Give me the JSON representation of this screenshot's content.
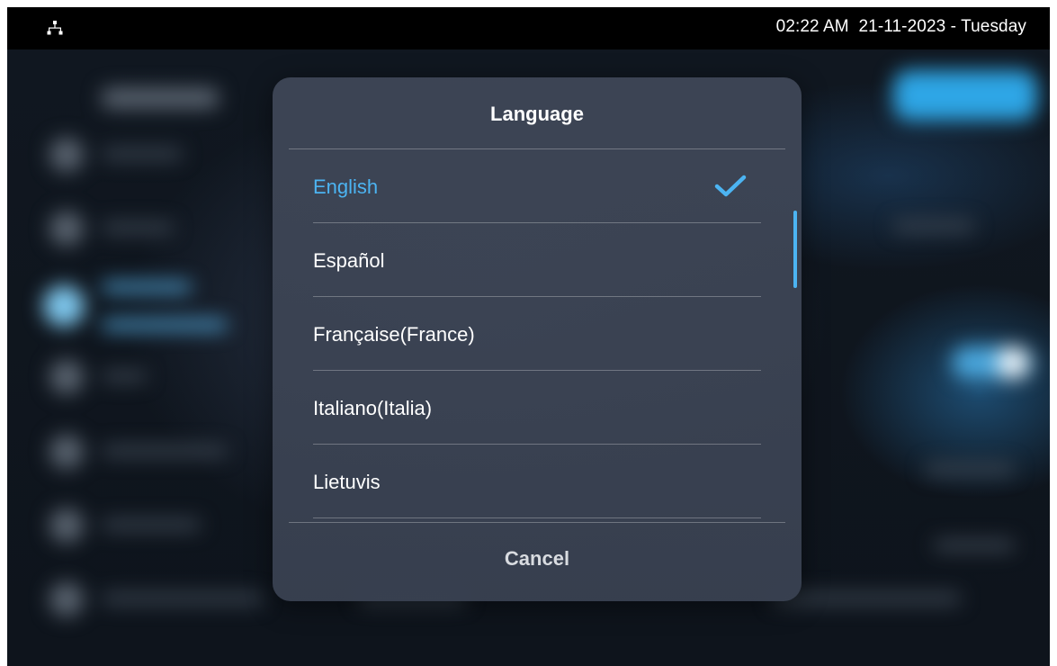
{
  "status_bar": {
    "time": "02:22 AM",
    "date": "21-11-2023 - Tuesday",
    "network_icon": "network-tree-icon"
  },
  "dialog": {
    "title": "Language",
    "options": [
      {
        "label": "English",
        "selected": true
      },
      {
        "label": "Español",
        "selected": false
      },
      {
        "label": "Française(France)",
        "selected": false
      },
      {
        "label": "Italiano(Italia)",
        "selected": false
      },
      {
        "label": "Lietuvis",
        "selected": false
      }
    ],
    "selected_icon": "checkmark-icon",
    "cancel_label": "Cancel"
  },
  "colors": {
    "accent": "#4cb4f2",
    "dialog_background": "#3b4354",
    "status_bar": "#000000"
  }
}
